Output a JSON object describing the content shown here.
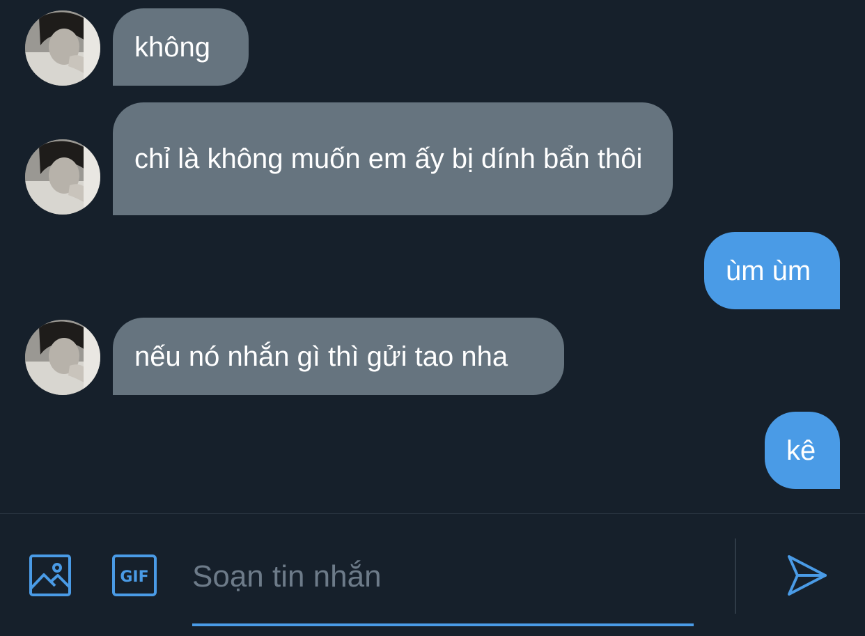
{
  "colors": {
    "background": "#16202b",
    "incoming_bubble": "#66747f",
    "outgoing_bubble": "#4a9be6",
    "accent": "#4a9be6",
    "placeholder": "#6d7b89"
  },
  "messages": [
    {
      "direction": "incoming",
      "text": "không"
    },
    {
      "direction": "incoming",
      "text": "chỉ là không muốn em ấy bị dính bẩn thôi"
    },
    {
      "direction": "outgoing",
      "text": "ùm ùm"
    },
    {
      "direction": "incoming",
      "text": "nếu nó nhắn gì thì gửi tao nha"
    },
    {
      "direction": "outgoing",
      "text": "kê"
    }
  ],
  "composer": {
    "image_icon": "image-icon",
    "gif_icon": "gif-icon",
    "gif_label": "GIF",
    "placeholder": "Soạn tin nhắn",
    "value": "",
    "send_icon": "send-icon"
  }
}
